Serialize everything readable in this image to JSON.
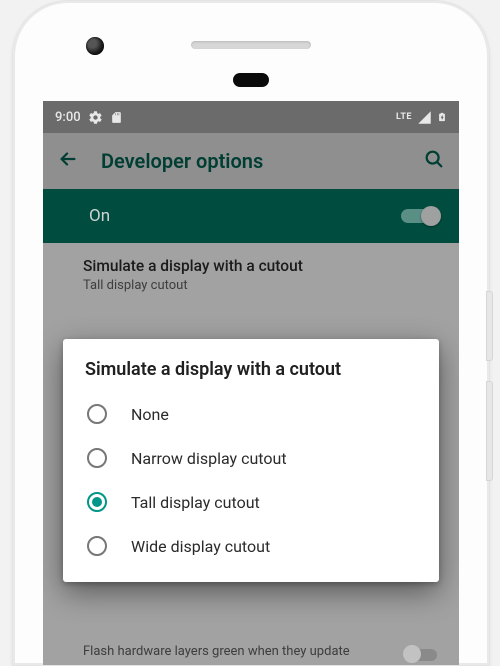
{
  "statusbar": {
    "time": "9:00",
    "lte_label": "LTE"
  },
  "appbar": {
    "title": "Developer options"
  },
  "master_toggle": {
    "label": "On",
    "checked": true
  },
  "settings": {
    "cutout_pref": {
      "title": "Simulate a display with a cutout",
      "subtitle": "Tall display cutout"
    },
    "other_visible": {
      "text": "Flash hardware layers green when they update"
    }
  },
  "dialog": {
    "title": "Simulate a display with a cutout",
    "options": [
      {
        "label": "None",
        "selected": false
      },
      {
        "label": "Narrow display cutout",
        "selected": false
      },
      {
        "label": "Tall display cutout",
        "selected": true
      },
      {
        "label": "Wide display cutout",
        "selected": false
      }
    ]
  },
  "colors": {
    "accent": "#009688",
    "teal_dark": "#004d40"
  }
}
